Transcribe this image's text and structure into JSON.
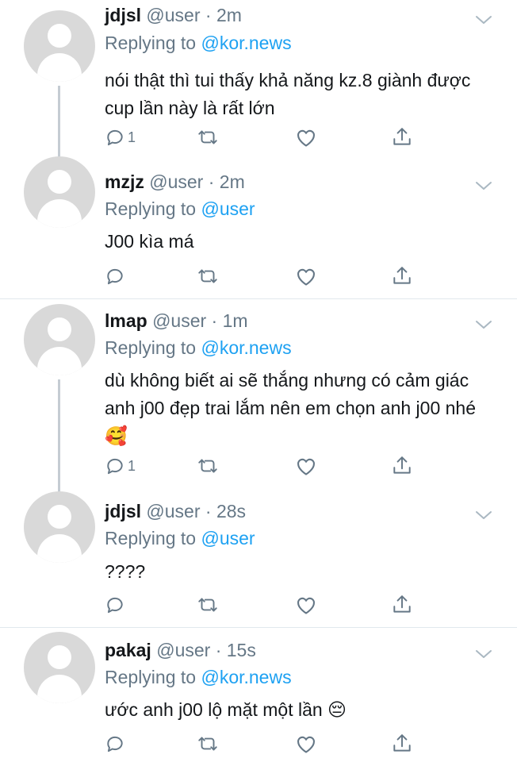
{
  "icons": {
    "reply": "reply-icon",
    "retweet": "retweet-icon",
    "like": "heart-icon",
    "share": "share-icon",
    "more": "chevron-down-icon",
    "avatar": "default-avatar-icon"
  },
  "colors": {
    "name": "#14171a",
    "meta": "#657786",
    "mention": "#1da1f2",
    "avatar": "#d9d9d9",
    "thread_line": "#c5ccd3",
    "divider": "#e1e8ed"
  },
  "reply_prefix": "Replying to",
  "tweets": [
    {
      "name": "jdjsl",
      "handle": "@user",
      "time": "2m",
      "replying_to": "@kor.news",
      "text": "nói thật thì tui thấy khả năng kz.8 giành được cup lần này là rất lớn",
      "reply_count": "1"
    },
    {
      "name": "mzjz",
      "handle": "@user",
      "time": "2m",
      "replying_to": "@user",
      "text": "J00 kìa má",
      "reply_count": ""
    },
    {
      "name": "lmap",
      "handle": "@user",
      "time": "1m",
      "replying_to": "@kor.news",
      "text": "dù không biết ai sẽ thắng nhưng có cảm giác anh j00 đẹp trai lắm nên em chọn anh j00 nhé 🥰",
      "reply_count": "1"
    },
    {
      "name": "jdjsl",
      "handle": "@user",
      "time": "28s",
      "replying_to": "@user",
      "text": "????",
      "reply_count": ""
    },
    {
      "name": "pakaj",
      "handle": "@user",
      "time": "15s",
      "replying_to": "@kor.news",
      "text": "ước anh j00 lộ mặt một lần 😔",
      "reply_count": ""
    }
  ]
}
